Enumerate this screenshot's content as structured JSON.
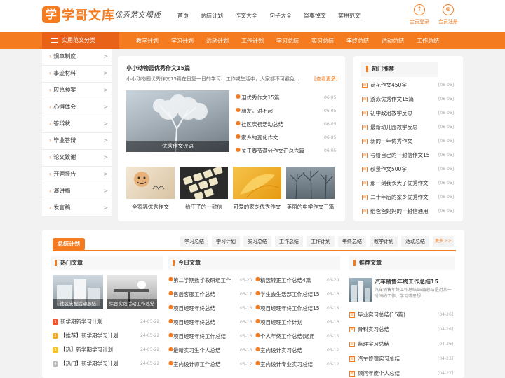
{
  "brand": {
    "logo": "学",
    "name": "学哥文库",
    "slogan": "优秀范文模板"
  },
  "nav": [
    "首页",
    "总结计划",
    "作文大全",
    "句子大全",
    "祭奠悼文",
    "实用范文"
  ],
  "account": [
    {
      "icon": "↑",
      "label": "会员登录"
    },
    {
      "icon": "⊕",
      "label": "会员注册"
    }
  ],
  "category_label": "实用范文分类",
  "orange_nav": [
    "教学计划",
    "学习计划",
    "活动计划",
    "工作计划",
    "学习总结",
    "实习总结",
    "年终总结",
    "活动总结",
    "工作总结"
  ],
  "sidebar": [
    "规章制度",
    "事迹材料",
    "应急预案",
    "心得体会",
    "答辩状",
    "毕业答辩",
    "论文致谢",
    "开题报告",
    "演讲稿",
    "发言稿"
  ],
  "featured": {
    "title": "小小动物园优秀作文15篇",
    "desc": "小小动物园优秀作文15篇在日复一日的学习、工作或生活中，大家都不可避免...",
    "more": "[查看更多]",
    "main_caption": "优秀作文评语",
    "list": [
      {
        "t": "泪优秀作文15篇",
        "d": "06-05"
      },
      {
        "t": "朋友，对不起",
        "d": "06-05"
      },
      {
        "t": "社区庆祝活动总结",
        "d": "06-05"
      },
      {
        "t": "家乡的变化作文",
        "d": "06-05"
      },
      {
        "t": "关于春节满分作文汇总六篇",
        "d": "06-05"
      }
    ],
    "thumbs": [
      "全家福优秀作文",
      "给庄子的一封信",
      "可爱的家乡优秀作文",
      "美丽的中学作文三篇"
    ]
  },
  "hot": {
    "title": "热门推荐",
    "items": [
      {
        "t": "荷花作文450字",
        "d": "[06-05]"
      },
      {
        "t": "游泳优秀作文15篇",
        "d": "[06-05]"
      },
      {
        "t": "初中政治教学反思",
        "d": "[06-05]"
      },
      {
        "t": "最新幼儿园教学反思",
        "d": "[06-05]"
      },
      {
        "t": "新的一年优秀作文",
        "d": "[06-05]"
      },
      {
        "t": "写给自己的一封信作文15",
        "d": "[06-05]"
      },
      {
        "t": "秋景作文500字",
        "d": "[06-05]"
      },
      {
        "t": "那一刻我长大了优秀作文",
        "d": "[06-05]"
      },
      {
        "t": "二十年后的家乡优秀作文",
        "d": "[06-05]"
      },
      {
        "t": "给爸爸妈妈的一封信通用",
        "d": "[06-05]"
      }
    ]
  },
  "summary": {
    "label": "总结计划",
    "tabs": [
      "学习总结",
      "学习计划",
      "实习总结",
      "工作总结",
      "工作计划",
      "年终总结",
      "教学计划",
      "活动总结"
    ],
    "more": "更多 >>"
  },
  "hotarticles": {
    "title": "热门文章",
    "pics": [
      "社区庆祝活动总结",
      "综合实践活动工作总结"
    ],
    "items": [
      {
        "t": "新学期新学习计划",
        "d": "24-05-22"
      },
      {
        "t": "【推荐】新学期学习计划",
        "d": "24-05-22"
      },
      {
        "t": "【热】新学期学习计划",
        "d": "24-05-22"
      },
      {
        "t": "【热门】新学期学习计划",
        "d": "24-05-22"
      }
    ]
  },
  "today": {
    "title": "今日文章",
    "left": [
      {
        "t": "第二学期数学教研组工作",
        "d": "05-20"
      },
      {
        "t": "售后客服工作总结",
        "d": "05-17"
      },
      {
        "t": "项目经理年终总结",
        "d": "05-16"
      },
      {
        "t": "项目经理年终总结",
        "d": "05-16"
      },
      {
        "t": "项目经理年终工作总结",
        "d": "05-16"
      },
      {
        "t": "最新实习生个人总结",
        "d": "05-13"
      },
      {
        "t": "室内设计师工作总结",
        "d": "05-12"
      }
    ],
    "right": [
      {
        "t": "精选转正工作总结4篇",
        "d": "05-20"
      },
      {
        "t": "学生会生活部工作总结15",
        "d": "05-16"
      },
      {
        "t": "项目经理年终工作总结15",
        "d": "05-16"
      },
      {
        "t": "项目经理工作计划",
        "d": "05-16"
      },
      {
        "t": "个人年终工作总结(通用",
        "d": "05-15"
      },
      {
        "t": "室内设计实习总结",
        "d": "05-12"
      },
      {
        "t": "室内设计专业实习总结",
        "d": "05-12"
      }
    ]
  },
  "recommend": {
    "title": "推荐文章",
    "feature_title": "汽车销售年终工作总结15",
    "feature_desc": "汽车销售年终工作总结15篇总结是对某一时间的工作、学习或思想...",
    "items": [
      {
        "t": "毕业实习总结(15篇)",
        "d": "[04-26]"
      },
      {
        "t": "骨科实习总结",
        "d": "[04-26]"
      },
      {
        "t": "监理实习总结",
        "d": "[04-26]"
      },
      {
        "t": "汽车修理实习总结",
        "d": "[04-23]"
      },
      {
        "t": "顾问年度个人总结",
        "d": "[04-22]"
      }
    ]
  }
}
